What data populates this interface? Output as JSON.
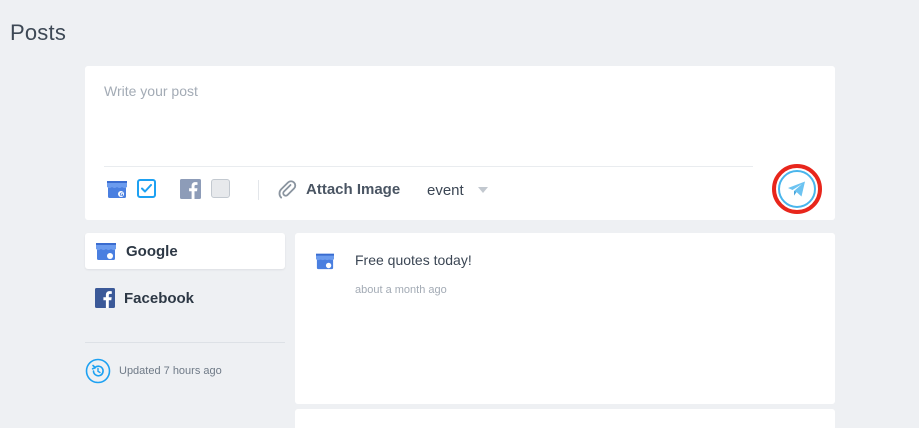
{
  "page": {
    "title": "Posts"
  },
  "composer": {
    "placeholder": "Write your post",
    "value": "",
    "google_checked": true,
    "facebook_checked": false,
    "attach_label": "Attach Image",
    "post_type": "event"
  },
  "sidebar": {
    "items": [
      {
        "label": "Google",
        "icon": "google-my-business-icon",
        "active": true
      },
      {
        "label": "Facebook",
        "icon": "facebook-icon",
        "active": false
      }
    ],
    "updated": "Updated 7 hours ago"
  },
  "feed": {
    "posts": [
      {
        "text": "Free quotes today!",
        "time": "about a month ago",
        "icon": "google-my-business-icon"
      }
    ]
  },
  "colors": {
    "background": "#eef0f3",
    "accent": "#1da1f2",
    "send_highlight": "#e8261c",
    "google_blue": "#4a7fe0",
    "facebook_blue": "#3b5998"
  }
}
